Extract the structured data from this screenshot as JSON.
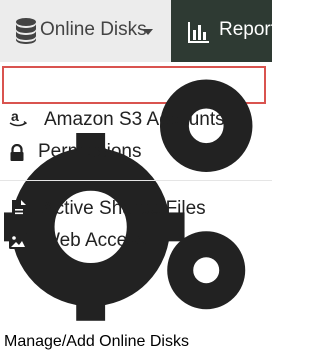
{
  "nav": {
    "online_disks": {
      "label": "Online Disks",
      "icon": "database-icon"
    },
    "reports": {
      "label": "Reports",
      "icon": "bar-chart-icon"
    }
  },
  "dropdown": {
    "items": [
      {
        "label": "Manage/Add Online Disks",
        "icon": "cogs-icon",
        "highlighted": true
      },
      {
        "label": "Amazon S3 Accounts",
        "icon": "amazon-icon"
      },
      {
        "label": "Permissions",
        "icon": "lock-icon"
      },
      {
        "label": "Active Shared Files",
        "icon": "file-icon"
      },
      {
        "label": "Web Access",
        "icon": "image-icon"
      }
    ]
  },
  "colors": {
    "topbar_bg": "#ececec",
    "reports_bg": "#2e3a33",
    "highlight_border": "#d9534f"
  }
}
